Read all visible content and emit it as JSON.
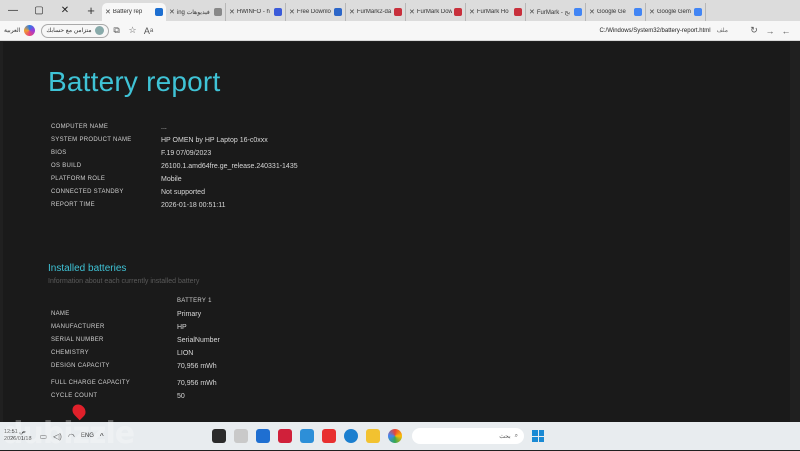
{
  "window_controls": {
    "minimize": "—",
    "restore": "▢",
    "close": "✕"
  },
  "newtab_label": "+",
  "tabs": [
    {
      "label": "Battery rep",
      "active": true,
      "color": "#1d6fd1"
    },
    {
      "label": "ing فيديوهات",
      "active": false,
      "color": "#888888"
    },
    {
      "label": "HWINFO - h",
      "active": false,
      "color": "#3b5bd9"
    },
    {
      "label": "Free Downlo",
      "active": false,
      "color": "#2c66c8"
    },
    {
      "label": "FurMark2-da",
      "active": false,
      "color": "#c8303c"
    },
    {
      "label": "FurMark Dow",
      "active": false,
      "color": "#c8303c"
    },
    {
      "label": "FurMark Ho",
      "active": false,
      "color": "#c8303c"
    },
    {
      "label": "FurMark - بح",
      "active": false,
      "color": "#4285f4"
    },
    {
      "label": "Google Ge",
      "active": false,
      "color": "#4285f4"
    },
    {
      "label": "Google Gem",
      "active": false,
      "color": "#4285f4"
    }
  ],
  "addressbar": {
    "url": "C:/Windows/System32/battery-report.html",
    "file_label": "ملف",
    "lang": "العربية",
    "signin": "متزامن مع حسابك"
  },
  "report": {
    "title": "Battery report",
    "system": [
      {
        "key": "COMPUTER NAME",
        "value": "..."
      },
      {
        "key": "SYSTEM PRODUCT NAME",
        "value": "HP OMEN by HP Laptop 16-c0xxx"
      },
      {
        "key": "BIOS",
        "value": "F.19 07/09/2023"
      },
      {
        "key": "OS BUILD",
        "value": "26100.1.amd64fre.ge_release.240331-1435"
      },
      {
        "key": "PLATFORM ROLE",
        "value": "Mobile"
      },
      {
        "key": "CONNECTED STANDBY",
        "value": "Not supported"
      },
      {
        "key": "REPORT TIME",
        "value": "2026-01-18  00:51:11"
      }
    ],
    "installed_title": "Installed batteries",
    "installed_subtitle": "Information about each currently installed battery",
    "battery_header": "BATTERY 1",
    "battery": [
      {
        "key": "NAME",
        "value": "Primary"
      },
      {
        "key": "MANUFACTURER",
        "value": "HP"
      },
      {
        "key": "SERIAL NUMBER",
        "value": "SerialNumber"
      },
      {
        "key": "CHEMISTRY",
        "value": "LION"
      },
      {
        "key": "DESIGN CAPACITY",
        "value": "70,956 mWh"
      },
      {
        "key": "FULL CHARGE CAPACITY",
        "value": "70,956 mWh"
      },
      {
        "key": "CYCLE COUNT",
        "value": "50"
      }
    ]
  },
  "taskbar": {
    "clock_time": "12:51 ص",
    "clock_date": "2026/01/18",
    "lang": "ENG",
    "search_placeholder": "بحث",
    "watermark": "dubizzle"
  }
}
